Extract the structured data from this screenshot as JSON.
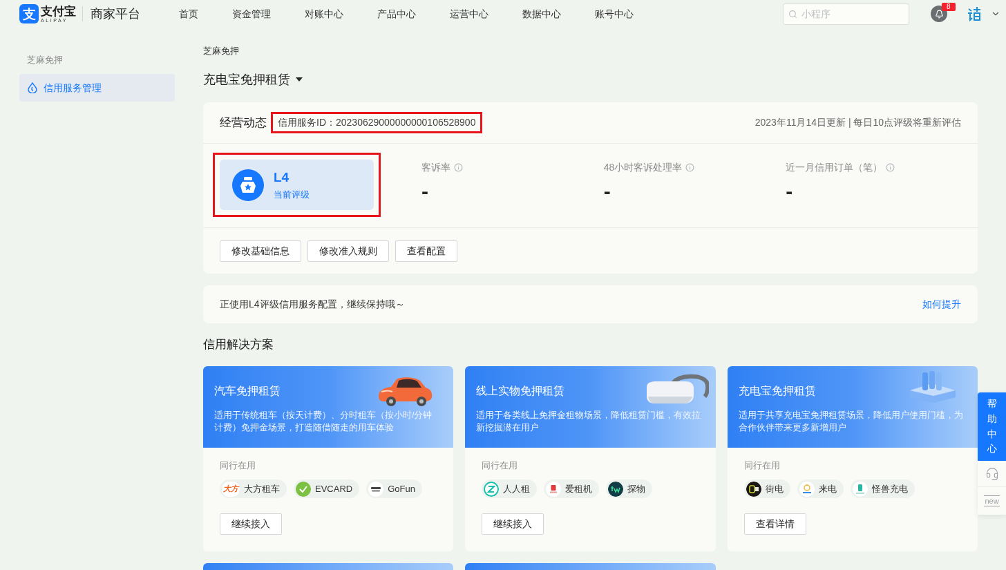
{
  "top_bar": {
    "logo": {
      "mark": "支",
      "name": "支付宝",
      "latin": "ALIPAY"
    },
    "platform": "商家平台",
    "nav": [
      {
        "label": "首页"
      },
      {
        "label": "资金管理"
      },
      {
        "label": "对账中心"
      },
      {
        "label": "产品中心"
      },
      {
        "label": "运营中心"
      },
      {
        "label": "数据中心"
      },
      {
        "label": "账号中心"
      }
    ],
    "search": {
      "placeholder": "小程序"
    },
    "notifications": {
      "count": "8"
    }
  },
  "sidebar": {
    "group": "芝麻免押",
    "items": [
      {
        "label": "信用服务管理",
        "selected": true
      }
    ]
  },
  "breadcrumb": "芝麻免押",
  "product_switcher": {
    "label": "充电宝免押租赁"
  },
  "overview": {
    "title": "经营动态",
    "service_id": {
      "text": "信用服务ID：20230629000000000106528900",
      "highlighted": true
    },
    "update_note": "2023年11月14日更新 | 每日10点评级将重新评估",
    "level": {
      "value": "L4",
      "caption": "当前评级",
      "highlighted": true
    },
    "metrics": [
      {
        "label": "客诉率",
        "value": "-"
      },
      {
        "label": "48小时客诉处理率",
        "value": "-"
      },
      {
        "label": "近一月信用订单（笔）",
        "value": "-"
      }
    ],
    "actions": [
      "修改基础信息",
      "修改准入规则",
      "查看配置"
    ]
  },
  "notice": {
    "text": "正使用L4评级信用服务配置，继续保持哦～",
    "link": "如何提升"
  },
  "solutions": {
    "title": "信用解决方案",
    "cards": [
      {
        "kind": "car",
        "title": "汽车免押租赁",
        "description": "适用于传统租车（按天计费）、分时租车（按小时/分钟计费）免押金场景，打造随借随走的用车体验",
        "peers_label": "同行在用",
        "peers": [
          {
            "kind": "dafang",
            "logo_text": "大方",
            "name": "大方租车"
          },
          {
            "kind": "evcard",
            "name": "EVCARD"
          },
          {
            "kind": "gofun",
            "name": "GoFun"
          }
        ],
        "button": "继续接入"
      },
      {
        "kind": "headset",
        "title": "线上实物免押租赁",
        "description": "适用于各类线上免押金租物场景，降低租赁门槛，有效拉新挖掘潜在用户",
        "peers_label": "同行在用",
        "peers": [
          {
            "kind": "renrenzu",
            "name": "人人租"
          },
          {
            "kind": "aizuji",
            "name": "爱租机"
          },
          {
            "kind": "tanwu",
            "name": "探物"
          }
        ],
        "button": "继续接入"
      },
      {
        "kind": "charger",
        "title": "充电宝免押租赁",
        "description": "适用于共享充电宝免押租赁场景，降低用户使用门槛，为合作伙伴带来更多新增用户",
        "peers_label": "同行在用",
        "peers": [
          {
            "kind": "jiedian",
            "name": "街电"
          },
          {
            "kind": "laidian",
            "name": "来电"
          },
          {
            "kind": "guaishou",
            "name": "怪兽充电"
          }
        ],
        "button": "查看详情"
      }
    ]
  },
  "help": {
    "label": "帮助中心",
    "badge": "new"
  }
}
